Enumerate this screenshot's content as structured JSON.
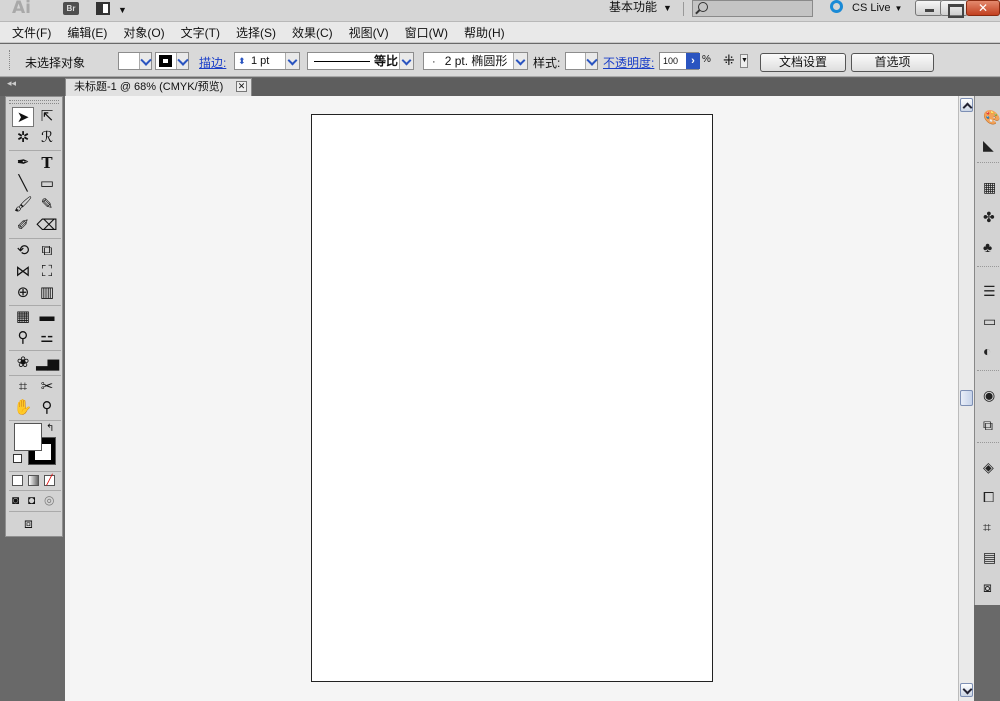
{
  "app": {
    "logo": "Ai",
    "bridge": "Br"
  },
  "titlebar": {
    "workspace": "基本功能",
    "search_placeholder": "",
    "cslive": "CS Live"
  },
  "menu": [
    "文件(F)",
    "编辑(E)",
    "对象(O)",
    "文字(T)",
    "选择(S)",
    "效果(C)",
    "视图(V)",
    "窗口(W)",
    "帮助(H)"
  ],
  "controlbar": {
    "selection": "未选择对象",
    "stroke_label": "描边:",
    "stroke_weight": "1 pt",
    "profile": "等比",
    "brush": "2 pt. 椭圆形",
    "style_label": "样式:",
    "opacity_label": "不透明度:",
    "opacity_value": "100",
    "percent": "%",
    "doc_setup": "文档设置",
    "preferences": "首选项"
  },
  "document": {
    "tab_title": "未标题-1 @ 68% (CMYK/预览)"
  },
  "colors": {
    "chrome": "#d6d6d6",
    "pasteboard": "#f5f5f5",
    "artboard": "#ffffff",
    "background": "#696969",
    "link": "#1b3fc9",
    "cslive": "#1a8ad6",
    "close": "#c24020"
  }
}
